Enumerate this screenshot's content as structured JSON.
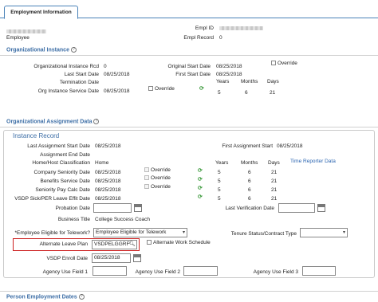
{
  "tab": {
    "label": "Employment Information"
  },
  "header": {
    "empl_id_label": "Empl ID",
    "empl_record_label": "Empl Record",
    "empl_record_value": "0",
    "role": "Employee"
  },
  "org_instance": {
    "title": "Organizational Instance",
    "org_instance_rcd_label": "Organizational Instance Rcd",
    "org_instance_rcd_value": "0",
    "last_start_date_label": "Last Start Date",
    "last_start_date_value": "08/25/2018",
    "termination_date_label": "Termination Date",
    "service_date_label": "Org Instance Service Date",
    "service_date_value": "08/25/2018",
    "original_start_label": "Original Start Date",
    "original_start_value": "08/25/2018",
    "first_start_label": "First Start Date",
    "first_start_value": "08/25/2018",
    "override_label": "Override",
    "years_label": "Years",
    "months_label": "Months",
    "days_label": "Days",
    "years": "5",
    "months": "6",
    "days": "21"
  },
  "org_assignment": {
    "title": "Organizational Assignment Data",
    "instance_title": "Instance Record",
    "last_assign_start_label": "Last Assignment Start Date",
    "last_assign_start_value": "08/25/2018",
    "assign_end_label": "Assignment End Date",
    "home_host_label": "Home/Host Classification",
    "home_host_value": "Home",
    "first_assign_start_label": "First Assignment Start",
    "first_assign_start_value": "08/25/2018",
    "years_label": "Years",
    "months_label": "Months",
    "days_label": "Days",
    "time_reporter_link": "Time Reporter Data",
    "seniority_rows": [
      {
        "label": "Company Seniority Date",
        "date": "08/25/2018",
        "override": "Override",
        "years": "5",
        "months": "6",
        "days": "21"
      },
      {
        "label": "Benefits Service Date",
        "date": "08/25/2018",
        "override": "Override",
        "years": "5",
        "months": "6",
        "days": "21"
      },
      {
        "label": "Seniority Pay Calc Date",
        "date": "08/25/2018",
        "override": "Override",
        "years": "5",
        "months": "6",
        "days": "21"
      },
      {
        "label": "VSDP Sick/PER Leave Effit Date",
        "date": "08/25/2018",
        "override": "",
        "years": "5",
        "months": "6",
        "days": "21"
      }
    ],
    "probation_label": "Probation Date",
    "last_verification_label": "Last Verification Date",
    "business_title_label": "Business Title",
    "business_title_value": "College Success Coach",
    "telework_label": "*Employee Eligible for Telework?",
    "telework_value": "Employee Eligible for Telework",
    "tenure_label": "Tenure Status/Contract Type",
    "tenure_value": "",
    "alt_leave_label": "Alternate Leave Plan",
    "alt_leave_value": "VSDPELGGRF",
    "alt_work_label": "Alternate Work Schedule",
    "vsdp_enroll_label": "VSDP Enroll Date",
    "vsdp_enroll_value": "08/25/2018",
    "agency_field1_label": "Agency Use Field 1",
    "agency_field2_label": "Agency Use Field 2",
    "agency_field3_label": "Agency Use Field 3"
  },
  "person_employment": {
    "title": "Person Employment Dates"
  },
  "colors": {
    "link": "#3d6ea6",
    "highlight": "#cc1f1f",
    "refresh": "#3b9a3b"
  }
}
